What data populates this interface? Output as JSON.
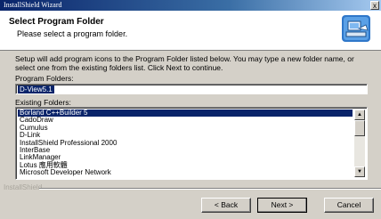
{
  "window": {
    "title": "InstallShield Wizard",
    "close_glyph": "x"
  },
  "header": {
    "title": "Select Program Folder",
    "subtitle": "Please select a program folder.",
    "icon": "computer-setup-icon"
  },
  "intro": "Setup will add program icons to the Program Folder listed below.  You may type a new folder name, or select one from the existing folders list.  Click Next to continue.",
  "program_folder": {
    "label": "Program Folders:",
    "value": "D-View5.1"
  },
  "existing_folders": {
    "label": "Existing Folders:",
    "items": [
      "Borland C++Builder 5",
      "CadoDraw",
      "Cumulus",
      "D-Link",
      "InstallShield Professional 2000",
      "InterBase",
      "LinkManager",
      "Lotus 應用軟體",
      "Microsoft Developer Network"
    ],
    "selected_index": 0
  },
  "footer": {
    "brand": "InstallShield",
    "back": "< Back",
    "next": "Next >",
    "cancel": "Cancel"
  }
}
